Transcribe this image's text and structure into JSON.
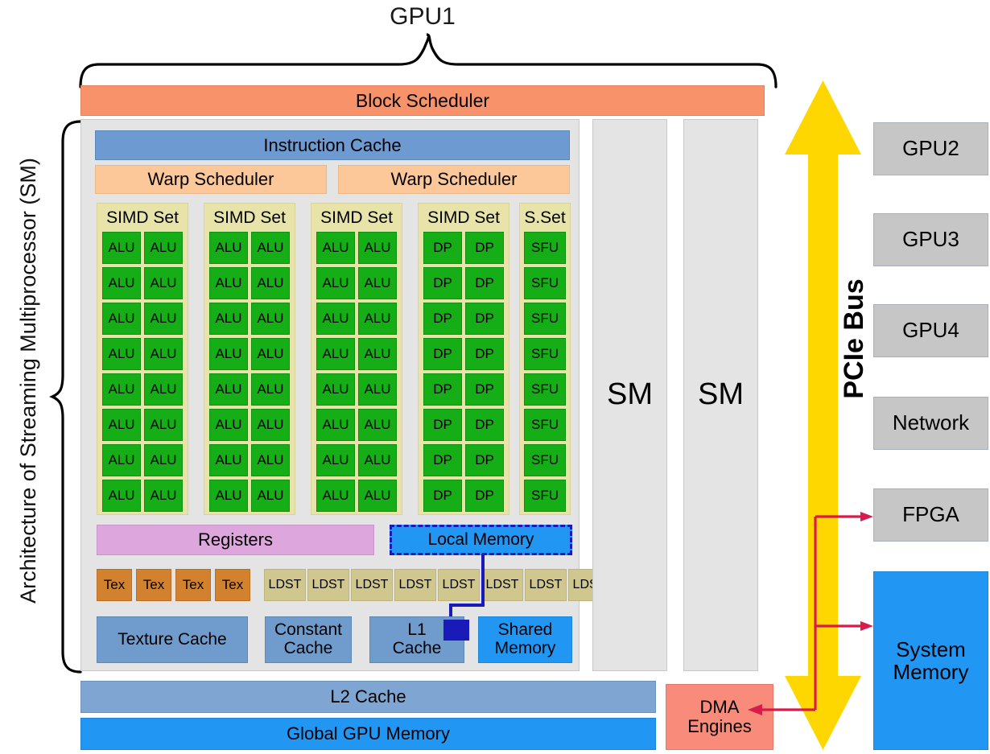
{
  "diagram": {
    "top_title": "GPU1",
    "side_label": "Architecture of Streaming Multiprocessor (SM)"
  },
  "sm": {
    "block_scheduler": "Block Scheduler",
    "instruction_cache": "Instruction Cache",
    "warp_schedulers": [
      "Warp Scheduler",
      "Warp Scheduler"
    ],
    "simd_sets": [
      {
        "title": "SIMD Set",
        "unit": "ALU",
        "count": 16,
        "columns": 2
      },
      {
        "title": "SIMD Set",
        "unit": "ALU",
        "count": 16,
        "columns": 2
      },
      {
        "title": "SIMD Set",
        "unit": "ALU",
        "count": 16,
        "columns": 2
      },
      {
        "title": "SIMD Set",
        "unit": "DP",
        "count": 16,
        "columns": 2
      },
      {
        "title": "S.Set",
        "unit": "SFU",
        "count": 8,
        "columns": 1
      }
    ],
    "registers": "Registers",
    "local_memory": "Local Memory",
    "tex_label": "Tex",
    "tex_count": 4,
    "ldst_label": "LDST",
    "ldst_count": 8,
    "texture_cache": "Texture Cache",
    "constant_cache_line1": "Constant",
    "constant_cache_line2": "Cache",
    "l1_cache_line1": "L1",
    "l1_cache_line2": "Cache",
    "shared_memory_line1": "Shared",
    "shared_memory_line2": "Memory",
    "other_sms": [
      "SM",
      "SM"
    ]
  },
  "gpu_memory": {
    "l2_cache": "L2 Cache",
    "global_gpu_memory": "Global GPU Memory",
    "dma_engines_line1": "DMA",
    "dma_engines_line2": "Engines"
  },
  "interconnect": {
    "pcie_label": "PCIe Bus",
    "devices": [
      "GPU2",
      "GPU3",
      "GPU4",
      "Network",
      "FPGA"
    ],
    "system_memory_line1": "System",
    "system_memory_line2": "Memory"
  },
  "colors": {
    "block_scheduler": "#f8926a",
    "instruction_cache": "#6d9bd1",
    "warp_scheduler": "#fcc89a",
    "simd_set": "#e8e3a9",
    "alu": "#16ae16",
    "registers": "#dda7dd",
    "local_memory": "#2196f3",
    "tex": "#d2822f",
    "ldst": "#cfc78e",
    "cache": "#6f9ccc",
    "l2_cache": "#7fa6d3",
    "global_memory": "#2196f3",
    "dma": "#f98b7b",
    "device_box": "#c6c6c6",
    "pcie_bus": "#ffd700",
    "red_link": "#d81b4a",
    "sm_panel": "#e4e4e4"
  }
}
